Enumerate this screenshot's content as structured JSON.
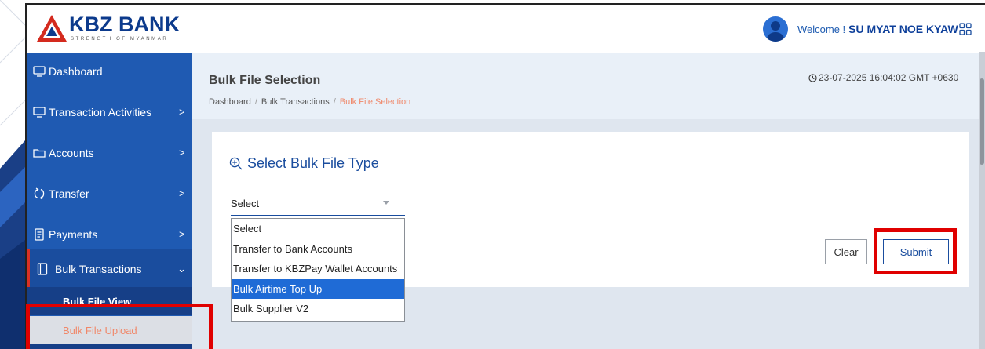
{
  "header": {
    "brand": "KBZ BANK",
    "tagline": "STRENGTH OF MYANMAR",
    "welcome_text": "Welcome !",
    "user_name": "SU MYAT NOE KYAW",
    "apps_icon": "grid-icon"
  },
  "sidebar": {
    "items": [
      {
        "label": "Dashboard",
        "icon": "monitor-icon",
        "chevron": ""
      },
      {
        "label": "Transaction Activities",
        "icon": "monitor-icon",
        "chevron": ">"
      },
      {
        "label": "Accounts",
        "icon": "folder-icon",
        "chevron": ">"
      },
      {
        "label": "Transfer",
        "icon": "transfer-icon",
        "chevron": ">"
      },
      {
        "label": "Payments",
        "icon": "receipt-icon",
        "chevron": ">"
      },
      {
        "label": "Bulk Transactions",
        "icon": "book-icon",
        "chevron": "⌄"
      }
    ],
    "sub_items": [
      {
        "label": "Bulk File View"
      },
      {
        "label": "Bulk File Upload"
      }
    ]
  },
  "main": {
    "page_title": "Bulk File Selection",
    "breadcrumb": [
      "Dashboard",
      "Bulk Transactions",
      "Bulk File Selection"
    ],
    "datetime": "23-07-2025 16:04:02 GMT +0630",
    "card_title": "Select Bulk File Type",
    "select_value": "Select",
    "dropdown_options": [
      "Select",
      "Transfer to Bank Accounts",
      "Transfer to KBZPay Wallet Accounts",
      "Bulk Airtime Top Up",
      "Bulk Supplier V2"
    ],
    "highlighted_option": "Bulk Airtime Top Up",
    "clear_label": "Clear",
    "submit_label": "Submit"
  },
  "colors": {
    "sidebar": "#1f5ab2",
    "brand_blue": "#0c3a8c",
    "accent_orange": "#f0886a",
    "highlight_red": "#e00000"
  }
}
